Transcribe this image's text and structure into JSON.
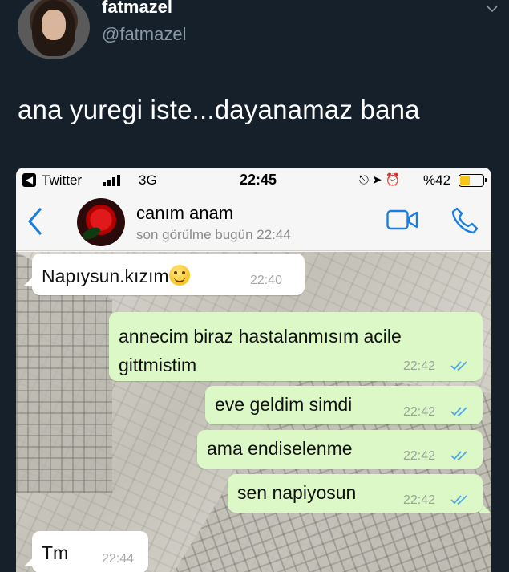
{
  "tweet": {
    "display_name": "fatmazel",
    "handle": "@fatmazel",
    "text": "ana yuregi iste...dayanamaz bana"
  },
  "status_bar": {
    "back_app": "Twitter",
    "network": "3G",
    "time": "22:45",
    "battery": "%42",
    "battery_level": 0.42
  },
  "chat": {
    "contact_name": "canım anam",
    "contact_status": "son görülme bugün 22:44",
    "messages": [
      {
        "direction": "in",
        "text": "Napıysun.kızım",
        "emoji": "smiling-face",
        "time": "22:40"
      },
      {
        "direction": "out",
        "text_line1": "annecim biraz hastalanmısım acile",
        "text_line2": "gittmistim",
        "time": "22:42",
        "read": true
      },
      {
        "direction": "out",
        "text": "eve geldim simdi",
        "time": "22:42",
        "read": true
      },
      {
        "direction": "out",
        "text": "ama endiselenme",
        "time": "22:42",
        "read": true
      },
      {
        "direction": "out",
        "text": "sen napiyosun",
        "time": "22:42",
        "read": true
      },
      {
        "direction": "in",
        "text": "Tm",
        "time": "22:44"
      }
    ]
  },
  "colors": {
    "page_bg": "#15202b",
    "outgoing_bubble": "#dcf8c6",
    "accent_blue": "#1a7ee0",
    "read_ticks": "#4fa6e8"
  }
}
